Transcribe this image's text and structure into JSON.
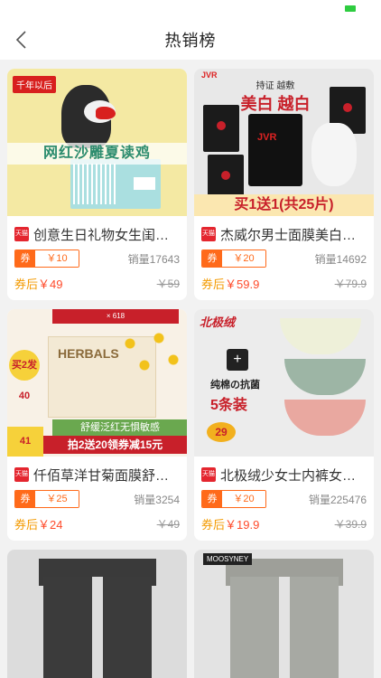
{
  "header": {
    "title": "热销榜"
  },
  "products": [
    {
      "title": "创意生日礼物女生闺蜜创意",
      "coupon_label": "券",
      "coupon_value": "￥10",
      "sales": "销量17643",
      "after_label": "券后",
      "after_price": "￥49",
      "orig_price": "￥59",
      "thumb": {
        "badge": "千年以后",
        "strip": "网红沙雕夏读鸡"
      }
    },
    {
      "title": "杰威尔男士面膜美白补水",
      "coupon_label": "券",
      "coupon_value": "￥20",
      "sales": "销量14692",
      "after_label": "券后",
      "after_price": "￥59.9",
      "orig_price": "￥79.9",
      "thumb": {
        "brand": "JVR",
        "headline_a": "持证 越敷",
        "headline_b": "美白 越白",
        "pack_label": "JVR",
        "bottom": "买1送1(共25片)"
      }
    },
    {
      "title": "仟佰草洋甘菊面膜舒缓补水",
      "coupon_label": "券",
      "coupon_value": "￥25",
      "sales": "销量3254",
      "after_label": "券后",
      "after_price": "￥24",
      "orig_price": "￥49",
      "thumb": {
        "topbar": "× 618",
        "box_label": "HERBALS",
        "circle": "买2发40",
        "banner1": "舒缓泛红无惧敏感",
        "banner2": "拍2送20领券减15元",
        "pricebox": "41"
      }
    },
    {
      "title": "北极绒少女士内裤女纯棉抗菌",
      "coupon_label": "券",
      "coupon_value": "￥20",
      "sales": "销量225476",
      "after_label": "券后",
      "after_price": "￥19.9",
      "orig_price": "￥39.9",
      "thumb": {
        "brand": "北极绒",
        "plus": "+",
        "label": "纯棉の抗菌",
        "label2": "5条装",
        "badge": "29"
      }
    }
  ],
  "partial": [
    {},
    {
      "tag": "MOOSYNEY"
    }
  ],
  "tmall_text": "天猫"
}
